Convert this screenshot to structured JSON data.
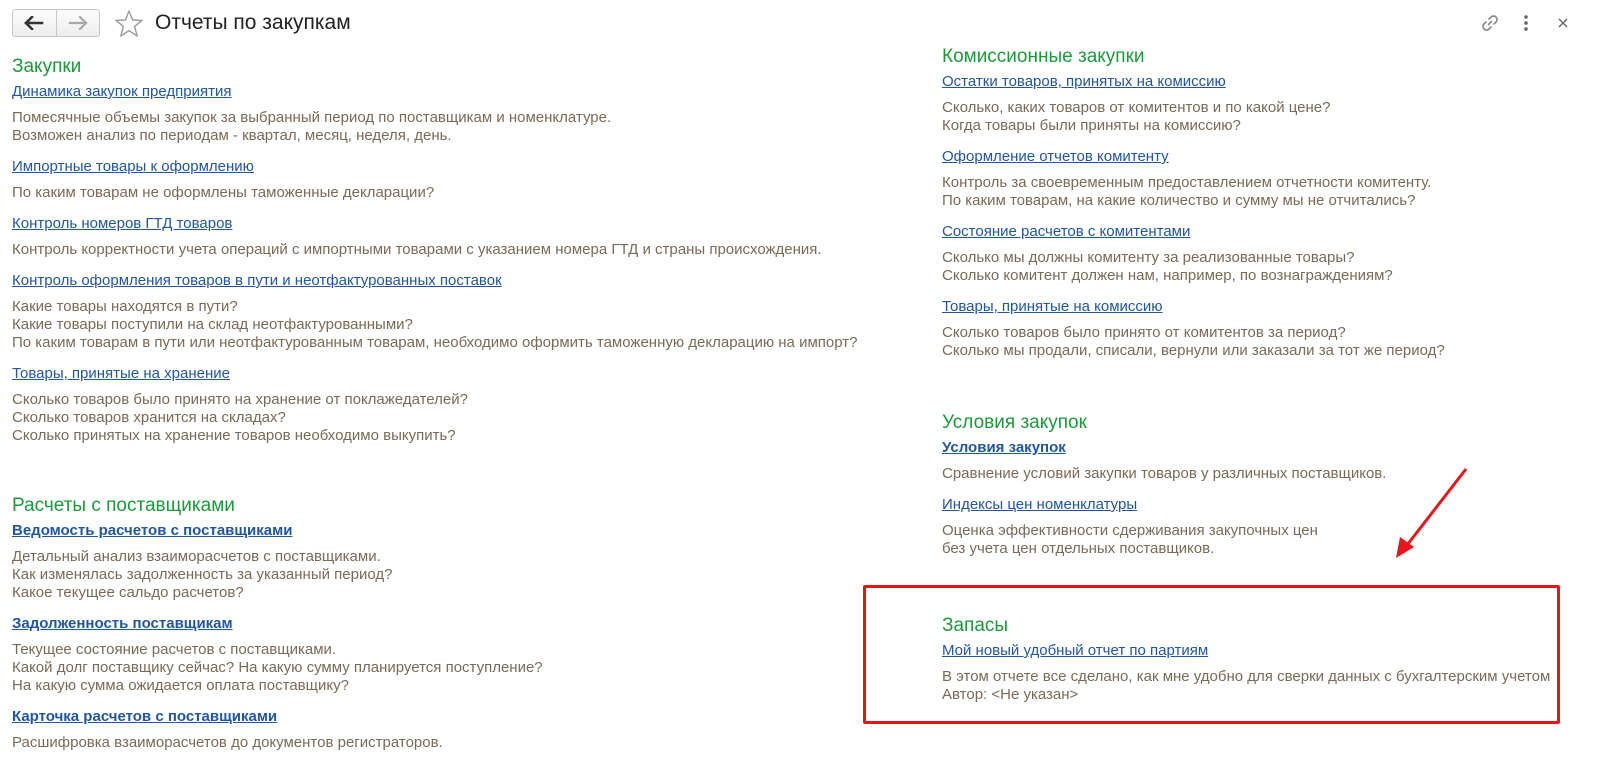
{
  "header": {
    "title": "Отчеты по закупкам",
    "icons": {
      "back": "arrow-left-icon",
      "forward": "arrow-right-icon",
      "favorite": "star-icon",
      "link": "link-icon",
      "more": "more-vertical-icon",
      "close": "close-icon"
    }
  },
  "left": {
    "purchases": {
      "title": "Закупки",
      "items": [
        {
          "label": "Динамика закупок предприятия",
          "desc": [
            "Помесячные объемы закупок за выбранный период по поставщикам и номенклатуре.",
            "Возможен анализ по периодам - квартал, месяц, неделя, день."
          ]
        },
        {
          "label": "Импортные товары к оформлению",
          "desc": [
            "По каким товарам не оформлены таможенные декларации?"
          ]
        },
        {
          "label": "Контроль номеров ГТД товаров",
          "desc": [
            "Контроль корректности учета операций с импортными товарами с указанием номера ГТД и страны происхождения."
          ]
        },
        {
          "label": "Контроль оформления товаров в пути и неотфактурованных поставок",
          "desc": [
            "Какие товары находятся в пути?",
            "Какие товары поступили на склад неотфактурованными?",
            "По каким товарам в пути или неотфактурованным товарам, необходимо оформить таможенную декларацию на импорт?"
          ]
        },
        {
          "label": "Товары, принятые на хранение",
          "desc": [
            "Сколько товаров было принято на хранение от поклажедателей?",
            "Сколько товаров хранится на складах?",
            "Сколько принятых на хранение товаров необходимо выкупить?"
          ]
        }
      ]
    },
    "settlements": {
      "title": "Расчеты с поставщиками",
      "items": [
        {
          "label": "Ведомость расчетов с поставщиками",
          "desc": [
            "Детальный анализ взаиморасчетов с поставщиками.",
            "Как изменялась задолженность за указанный период?",
            "Какое текущее сальдо расчетов?"
          ]
        },
        {
          "label": "Задолженность поставщикам",
          "desc": [
            "Текущее состояние расчетов с поставщиками.",
            "Какой долг поставщику сейчас? На какую сумму планируется поступление?",
            "На какую сумма ожидается оплата поставщику?"
          ]
        },
        {
          "label": "Карточка расчетов с поставщиками",
          "desc": [
            "Расшифровка взаиморасчетов до документов регистраторов."
          ]
        }
      ]
    }
  },
  "right": {
    "commission": {
      "title": "Комиссионные закупки",
      "items": [
        {
          "label": "Остатки товаров, принятых на комиссию",
          "desc": [
            "Сколько, каких товаров от комитентов и по какой цене?",
            "Когда товары были приняты на комиссию?"
          ]
        },
        {
          "label": "Оформление отчетов комитенту",
          "desc": [
            "Контроль за своевременным предоставлением отчетности комитенту.",
            "По каким товарам, на какие количество и сумму мы не отчитались?"
          ]
        },
        {
          "label": "Состояние расчетов с комитентами",
          "desc": [
            "Сколько мы должны комитенту за реализованные товары?",
            "Сколько комитент должен нам, например, по вознаграждениям?"
          ]
        },
        {
          "label": "Товары, принятые на комиссию",
          "desc": [
            "Сколько товаров было принято от комитентов за период?",
            "Сколько мы продали, списали, вернули или заказали за тот же период?"
          ]
        }
      ]
    },
    "conditions": {
      "title": "Условия закупок",
      "items": [
        {
          "label": "Условия закупок",
          "desc": [
            "Сравнение условий закупки товаров у различных поставщиков."
          ]
        },
        {
          "label": "Индексы цен номенклатуры",
          "desc": [
            "Оценка эффективности сдерживания закупочных цен",
            "без учета цен отдельных поставщиков."
          ]
        }
      ]
    },
    "stock": {
      "title": "Запасы",
      "items": [
        {
          "label": "Мой новый удобный отчет по партиям",
          "desc": [
            "В этом отчете все сделано, как мне удобно для сверки данных с бухгалтерским учетом",
            "Автор: <Не указан>"
          ]
        }
      ]
    }
  },
  "annotations": {
    "highlight_color": "#e8161a"
  },
  "colors": {
    "section_title": "#1b9a3a",
    "link": "#2155a5",
    "description": "#7a6a57"
  }
}
